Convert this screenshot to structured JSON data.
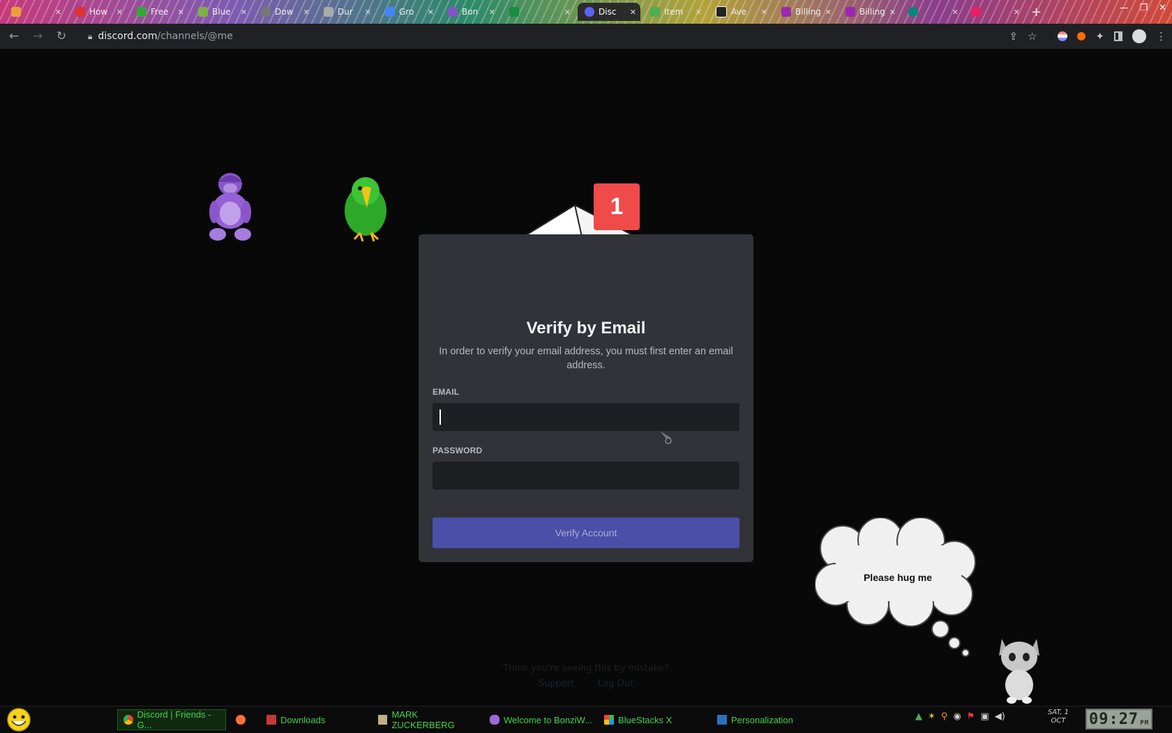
{
  "browser": {
    "tabs": [
      {
        "label": "",
        "color": "#e8a13a"
      },
      {
        "label": "How",
        "color": "#d33"
      },
      {
        "label": "Free",
        "color": "#3a3"
      },
      {
        "label": "Blue",
        "color": "#7cb342"
      },
      {
        "label": "Dow",
        "color": "#777"
      },
      {
        "label": "Dur",
        "color": "#aaa"
      },
      {
        "label": "Gro",
        "color": "#4285f4"
      },
      {
        "label": "Bon",
        "color": "#7e57c2"
      },
      {
        "label": "",
        "color": "#1b8c3a"
      },
      {
        "label": "Disc",
        "color": "#5865f2"
      },
      {
        "label": "Item",
        "color": "#4caf50"
      },
      {
        "label": "Ave",
        "color": "#222"
      },
      {
        "label": "Billing",
        "color": "#9c27b0"
      },
      {
        "label": "Billing",
        "color": "#9c27b0"
      },
      {
        "label": "",
        "color": "#00897b"
      },
      {
        "label": "",
        "color": "#e91e63"
      }
    ],
    "url_host": "discord.com",
    "url_path": "/channels/@me"
  },
  "modal": {
    "badge_count": "1",
    "title": "Verify by Email",
    "description": "In order to verify your email address, you must first enter an email address.",
    "email_label": "EMAIL",
    "email_value": "",
    "password_label": "PASSWORD",
    "password_value": "",
    "verify_button": "Verify Account",
    "accent_color": "#5865f2"
  },
  "footer": {
    "text": "Think you're seeing this by mistake?",
    "support_link": "Support",
    "logout_link": "Log Out"
  },
  "desktop": {
    "thought_bubble": "Please hug me"
  },
  "taskbar": {
    "items": [
      {
        "label": "Discord | Friends - G..."
      },
      {
        "label": ""
      },
      {
        "label": "Downloads"
      },
      {
        "label": "MARK ZUCKERBERG"
      },
      {
        "label": "Welcome to BonziW..."
      },
      {
        "label": "BlueStacks X"
      },
      {
        "label": "Personalization"
      }
    ],
    "date_day": "SAT, 1",
    "date_month": "OCT",
    "clock": "09:27",
    "clock_suffix": "PM"
  }
}
